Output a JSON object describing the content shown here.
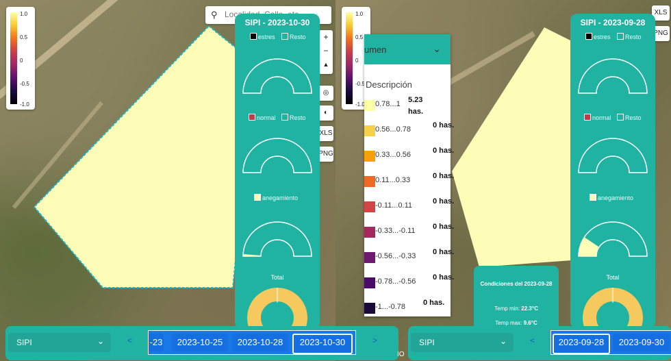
{
  "left": {
    "legend_ticks": [
      "1.0",
      "0.5",
      "0",
      "-0.5",
      "-1.0"
    ],
    "search_placeholder": "Localidad, Calle, etc.",
    "panel_title": "SIPI - 2023-10-30",
    "chk1": [
      "estres",
      "Resto"
    ],
    "chk2": [
      "normal",
      "Resto"
    ],
    "chk3": [
      "anegamiento"
    ],
    "total_label": "Total",
    "tool_btns": [
      "XLS",
      "PNG"
    ]
  },
  "right": {
    "legend_ticks": [
      "1.0",
      "0.5",
      "0",
      "-0.5",
      "-1.0"
    ],
    "panel_title": "SIPI - 2023-09-28",
    "chk1": [
      "estres",
      "Resto"
    ],
    "chk2": [
      "normal",
      "Resto"
    ],
    "chk3": [
      "anegamiento"
    ],
    "total_label": "Total",
    "tool_btns": [
      "XLS",
      "PNG"
    ]
  },
  "dropdown": {
    "title": "umen",
    "description_header": "Descripción",
    "rows": [
      {
        "range": "0.78...1",
        "value": "5.23 has.",
        "color": "#fcffa4"
      },
      {
        "range": "0.56...0.78",
        "value": "0 has.",
        "color": "#f6d047"
      },
      {
        "range": "0.33...0.56",
        "value": "0 has.",
        "color": "#f8a00a"
      },
      {
        "range": "0.11...0.33",
        "value": "0 has.",
        "color": "#ec6a24"
      },
      {
        "range": "-0.11...0.11",
        "value": "0 has.",
        "color": "#d04545"
      },
      {
        "range": "-0.33...-0.11",
        "value": "0 has.",
        "color": "#a6295e"
      },
      {
        "range": "-0.56...-0.33",
        "value": "0 has.",
        "color": "#6e1a6e"
      },
      {
        "range": "-0.78...-0.56",
        "value": "0 has.",
        "color": "#4a0c6b"
      },
      {
        "range": "-1...-0.78",
        "value": "0 has.",
        "color": "#1a0b3a"
      }
    ]
  },
  "conditions": {
    "title": "Condiciones del 2023-09-28",
    "tmin_label": "Temp min:",
    "tmin": "22.3°C",
    "tmax_label": "Temp max:",
    "tmax": "9.6°C"
  },
  "bottom_left": {
    "index": "SIPI",
    "prev": "<",
    "next": ">",
    "dates": [
      "-23",
      "2023-10-25",
      "2023-10-28",
      "2023-10-30"
    ]
  },
  "bottom_right": {
    "index": "SIPI",
    "prev": "<",
    "dates": [
      "2023-09-28",
      "2023-09-30"
    ]
  },
  "fragment_text": "IO",
  "colors": {
    "teal": "#21b3a2",
    "field": "#fdfdb8",
    "blue": "#166fe0"
  },
  "gauge_fills": {
    "left_anegamiento": 0.02,
    "right_anegamiento": 0.18
  }
}
